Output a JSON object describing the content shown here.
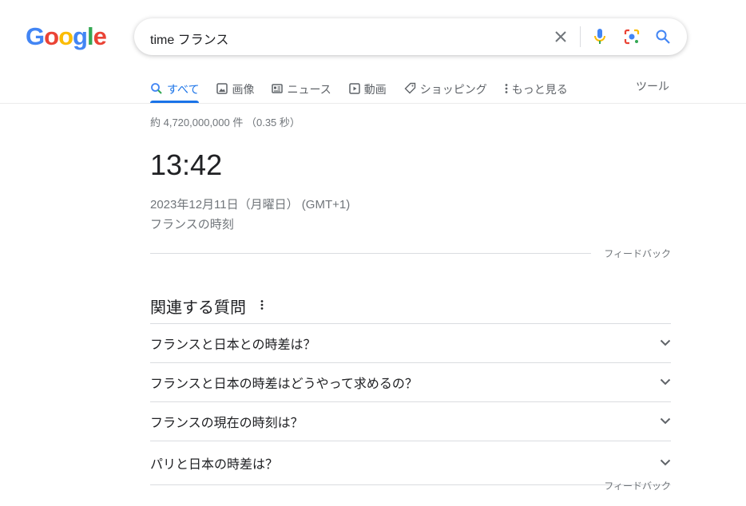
{
  "logo": "Google",
  "search": {
    "query": "time フランス"
  },
  "tabs": [
    {
      "label": "すべて",
      "icon": "search-icon"
    },
    {
      "label": "画像",
      "icon": "image-icon"
    },
    {
      "label": "ニュース",
      "icon": "news-icon"
    },
    {
      "label": "動画",
      "icon": "video-icon"
    },
    {
      "label": "ショッピング",
      "icon": "tag-icon"
    },
    {
      "label": "もっと見る",
      "icon": "more-vert-icon"
    }
  ],
  "tools": "ツール",
  "stats": "約 4,720,000,000 件 （0.35 秒）",
  "clock": {
    "time": "13:42",
    "date": "2023年12月11日（月曜日） (GMT+1)",
    "location": "フランスの時刻"
  },
  "feedback": "フィードバック",
  "paa": {
    "title": "関連する質問",
    "questions": [
      "フランスと日本との時差は？",
      "フランスと日本の時差はどうやって求めるの？",
      "フランスの現在の時刻は？",
      "パリと日本の時差は？"
    ]
  },
  "colors": {
    "accent": "#1a73e8",
    "blue": "#4285f4",
    "red": "#ea4335",
    "yellow": "#fbbc05",
    "green": "#34a853"
  }
}
